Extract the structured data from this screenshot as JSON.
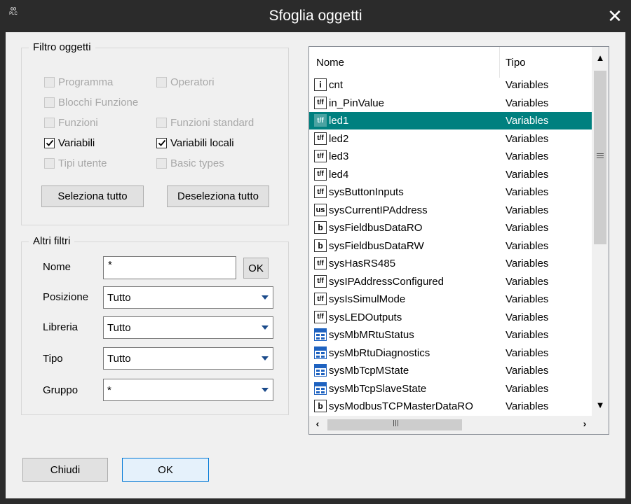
{
  "window": {
    "title": "Sfoglia oggetti",
    "app_icon_text": "PLC",
    "close_icon": "close-icon"
  },
  "filtro": {
    "title": "Filtro oggetti",
    "checkboxes": [
      {
        "label": "Programma",
        "checked": false,
        "enabled": false
      },
      {
        "label": "Operatori",
        "checked": false,
        "enabled": false
      },
      {
        "label": "Blocchi Funzione",
        "checked": false,
        "enabled": false
      },
      {
        "label": "Funzioni",
        "checked": false,
        "enabled": false
      },
      {
        "label": "Funzioni standard",
        "checked": false,
        "enabled": false
      },
      {
        "label": "Variabili",
        "checked": true,
        "enabled": true
      },
      {
        "label": "Variabili locali",
        "checked": true,
        "enabled": true
      },
      {
        "label": "Tipi utente",
        "checked": false,
        "enabled": false
      },
      {
        "label": "Basic types",
        "checked": false,
        "enabled": false
      }
    ],
    "select_all": "Seleziona tutto",
    "deselect_all": "Deseleziona tutto"
  },
  "altri": {
    "title": "Altri filtri",
    "nome_label": "Nome",
    "nome_value": "*",
    "ok_small": "OK",
    "posizione_label": "Posizione",
    "posizione_value": "Tutto",
    "libreria_label": "Libreria",
    "libreria_value": "Tutto",
    "tipo_label": "Tipo",
    "tipo_value": "Tutto",
    "gruppo_label": "Gruppo",
    "gruppo_value": "*"
  },
  "list": {
    "col_name": "Nome",
    "col_type": "Tipo",
    "rows": [
      {
        "icon": "i",
        "name": "cnt",
        "type": "Variables"
      },
      {
        "icon": "t/f",
        "name": "in_PinValue",
        "type": "Variables"
      },
      {
        "icon": "t/f",
        "name": "led1",
        "type": "Variables",
        "selected": true
      },
      {
        "icon": "t/f",
        "name": "led2",
        "type": "Variables"
      },
      {
        "icon": "t/f",
        "name": "led3",
        "type": "Variables"
      },
      {
        "icon": "t/f",
        "name": "led4",
        "type": "Variables"
      },
      {
        "icon": "t/f",
        "name": "sysButtonInputs",
        "type": "Variables"
      },
      {
        "icon": "us",
        "name": "sysCurrentIPAddress",
        "type": "Variables"
      },
      {
        "icon": "b",
        "name": "sysFieldbusDataRO",
        "type": "Variables"
      },
      {
        "icon": "b",
        "name": "sysFieldbusDataRW",
        "type": "Variables"
      },
      {
        "icon": "t/f",
        "name": "sysHasRS485",
        "type": "Variables"
      },
      {
        "icon": "t/f",
        "name": "sysIPAddressConfigured",
        "type": "Variables"
      },
      {
        "icon": "t/f",
        "name": "sysIsSimulMode",
        "type": "Variables"
      },
      {
        "icon": "t/f",
        "name": "sysLEDOutputs",
        "type": "Variables"
      },
      {
        "icon": "struct",
        "name": "sysMbMRtuStatus",
        "type": "Variables"
      },
      {
        "icon": "struct",
        "name": "sysMbRtuDiagnostics",
        "type": "Variables"
      },
      {
        "icon": "struct",
        "name": "sysMbTcpMState",
        "type": "Variables"
      },
      {
        "icon": "struct",
        "name": "sysMbTcpSlaveState",
        "type": "Variables"
      },
      {
        "icon": "b",
        "name": "sysModbusTCPMasterDataRO",
        "type": "Variables"
      }
    ]
  },
  "footer": {
    "close": "Chiudi",
    "ok": "OK"
  }
}
